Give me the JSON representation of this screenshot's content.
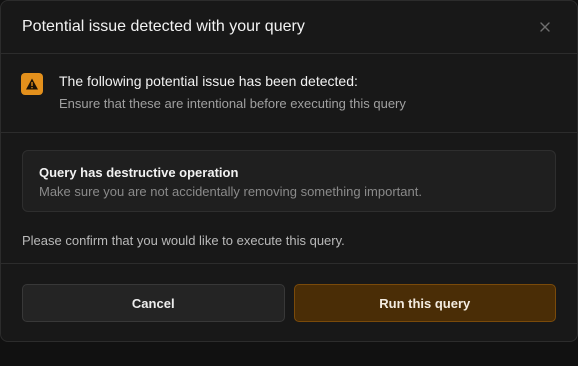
{
  "dialog": {
    "title": "Potential issue detected with your query",
    "close_icon": "close-icon"
  },
  "warning": {
    "icon": "warning-triangle-icon",
    "icon_color": "#e3901c",
    "headline": "The following potential issue has been detected:",
    "subtext": "Ensure that these are intentional before executing this query"
  },
  "operation": {
    "title": "Query has destructive operation",
    "description": "Make sure you are not accidentally removing something important."
  },
  "confirm_text": "Please confirm that you would like to execute this query.",
  "buttons": {
    "cancel_label": "Cancel",
    "run_label": "Run this query",
    "run_color": "#4a2d06"
  }
}
